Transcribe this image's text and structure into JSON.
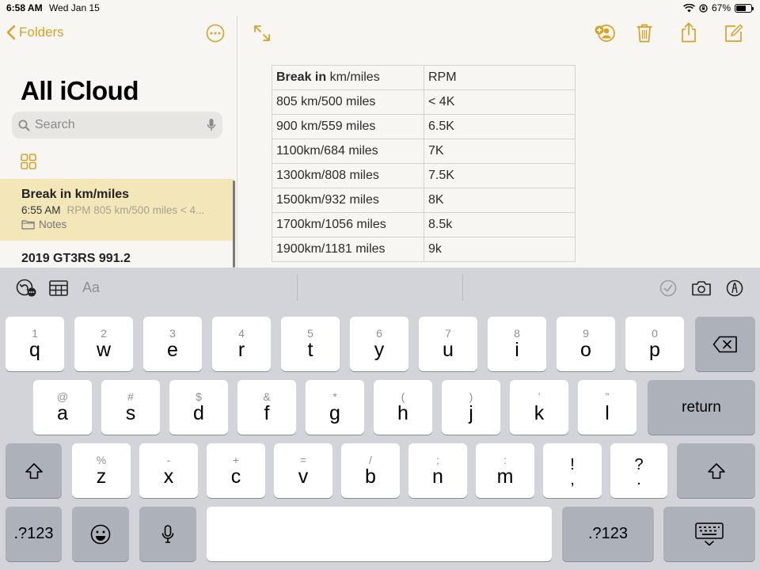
{
  "status_bar": {
    "time": "6:58 AM",
    "date": "Wed Jan 15",
    "battery": "67%"
  },
  "sidebar": {
    "back_label": "Folders",
    "title": "All iCloud",
    "search_placeholder": "Search",
    "notes": [
      {
        "title": "Break in km/miles",
        "time": "6:55 AM",
        "preview": "RPM 805 km/500 miles < 4...",
        "folder": "Notes"
      },
      {
        "title": "2019 GT3RS 991.2"
      }
    ]
  },
  "note_table": {
    "header": {
      "bold": "Break in",
      "rest": " km/miles",
      "col2": "RPM"
    },
    "rows": [
      [
        "805 km/500 miles",
        "< 4K"
      ],
      [
        "900 km/559 miles",
        "6.5K"
      ],
      [
        "1100km/684 miles",
        "7K"
      ],
      [
        "1300km/808 miles",
        "7.5K"
      ],
      [
        "1500km/932 miles",
        "8K"
      ],
      [
        "1700km/1056 miles",
        "8.5k"
      ],
      [
        "1900km/1181 miles",
        "9k"
      ]
    ]
  },
  "keyboard": {
    "format_label": "Aa",
    "row1": [
      {
        "k": "q",
        "h": "1"
      },
      {
        "k": "w",
        "h": "2"
      },
      {
        "k": "e",
        "h": "3"
      },
      {
        "k": "r",
        "h": "4"
      },
      {
        "k": "t",
        "h": "5"
      },
      {
        "k": "y",
        "h": "6"
      },
      {
        "k": "u",
        "h": "7"
      },
      {
        "k": "i",
        "h": "8"
      },
      {
        "k": "o",
        "h": "9"
      },
      {
        "k": "p",
        "h": "0"
      }
    ],
    "row2": [
      {
        "k": "a",
        "h": "@"
      },
      {
        "k": "s",
        "h": "#"
      },
      {
        "k": "d",
        "h": "$"
      },
      {
        "k": "f",
        "h": "&"
      },
      {
        "k": "g",
        "h": "*"
      },
      {
        "k": "h",
        "h": "("
      },
      {
        "k": "j",
        "h": ")"
      },
      {
        "k": "k",
        "h": "’"
      },
      {
        "k": "l",
        "h": "”"
      }
    ],
    "row3": [
      {
        "k": "z",
        "h": "%"
      },
      {
        "k": "x",
        "h": "-"
      },
      {
        "k": "c",
        "h": "+"
      },
      {
        "k": "v",
        "h": "="
      },
      {
        "k": "b",
        "h": "/"
      },
      {
        "k": "n",
        "h": ";"
      },
      {
        "k": "m",
        "h": ":"
      },
      {
        "k": ",",
        "h": "!"
      },
      {
        "k": ".",
        "h": "?"
      }
    ],
    "return_label": "return",
    "numbers_label": ".?123"
  },
  "colors": {
    "accent": "#d8a325",
    "selected_note": "#f3e6b8",
    "keyboard_bg": "#d2d4d9"
  }
}
